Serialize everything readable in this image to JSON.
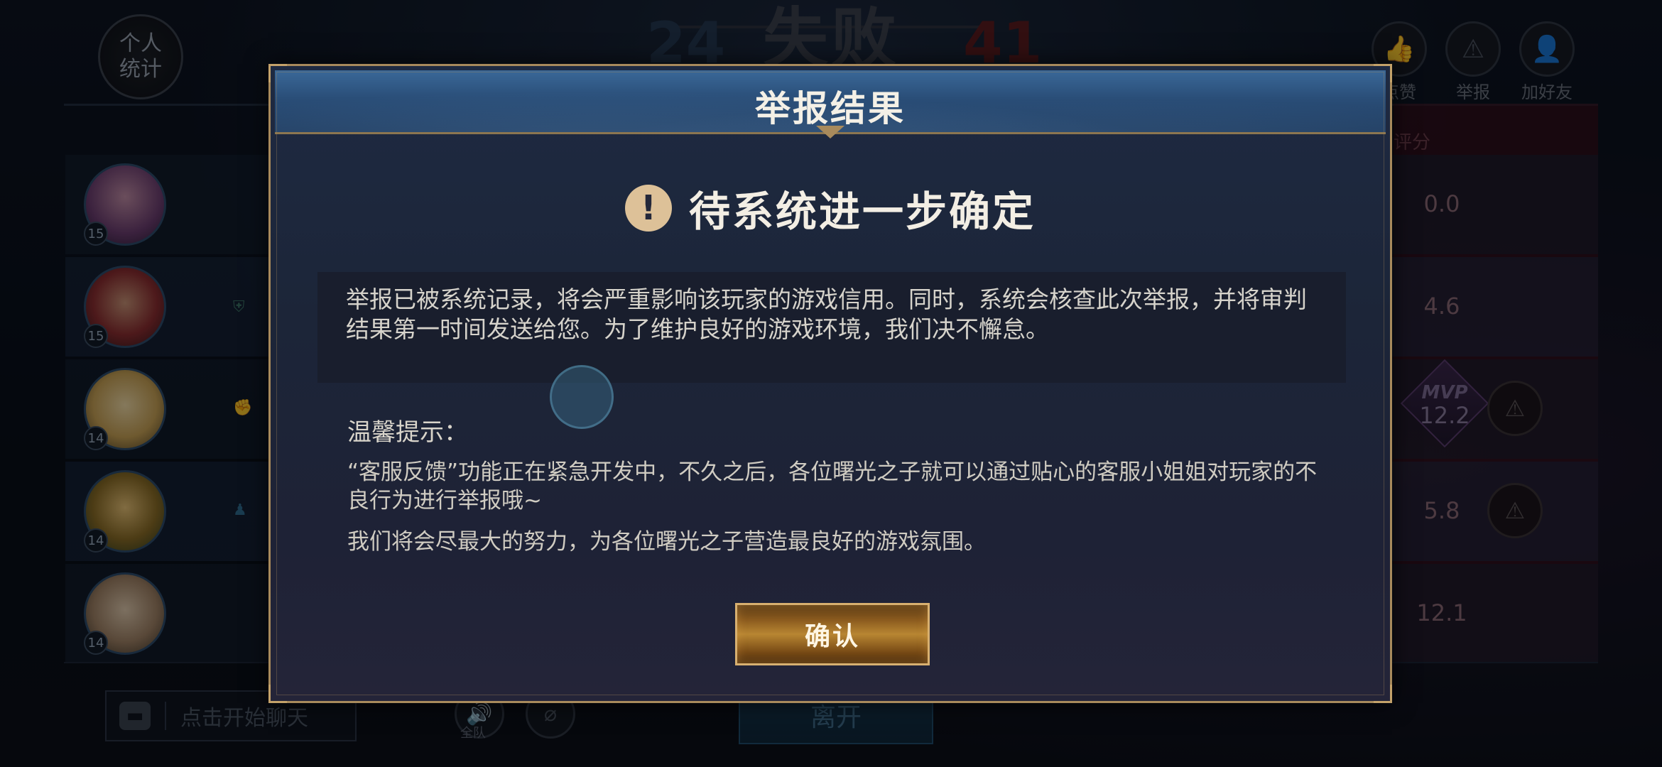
{
  "scoreboard": {
    "stats_button_label": "个人\n统计",
    "blue_score": "24",
    "red_score": "41",
    "result_text": "失败",
    "score_column_label": "评分"
  },
  "top_actions": [
    {
      "label": "点赞",
      "icon": "thumbs-up-icon"
    },
    {
      "label": "举报",
      "icon": "warning-icon"
    },
    {
      "label": "加好友",
      "icon": "add-friend-icon"
    }
  ],
  "players": [
    {
      "level": "15",
      "rating": "0.0"
    },
    {
      "level": "15",
      "rating": "4.6"
    },
    {
      "level": "14",
      "rating": "12.2",
      "mvp": "MVP"
    },
    {
      "level": "14",
      "rating": "5.8"
    },
    {
      "level": "14",
      "rating": "12.1"
    }
  ],
  "bottom_bar": {
    "chat_placeholder": "点击开始聊天",
    "voice_label": "全队",
    "leave_label": "离开"
  },
  "modal": {
    "title": "举报结果",
    "status": "待系统进一步确定",
    "status_icon": "!",
    "message": "举报已被系统记录，将会严重影响该玩家的游戏信用。同时，系统会核查此次举报，并将审判结果第一时间发送给您。为了维护良好的游戏环境，我们决不懈怠。",
    "tips_title": "温馨提示：",
    "tips": [
      "“客服反馈”功能正在紧急开发中，不久之后，各位曙光之子就可以通过贴心的客服小姐姐对玩家的不良行为进行举报哦~",
      "我们将会尽最大的努力，为各位曙光之子营造最良好的游戏氛围。"
    ],
    "confirm_label": "确认"
  },
  "colors": {
    "accent_gold": "#a88a5c",
    "header_blue": "#2a4e78",
    "confirm_gold": "#b88632"
  }
}
